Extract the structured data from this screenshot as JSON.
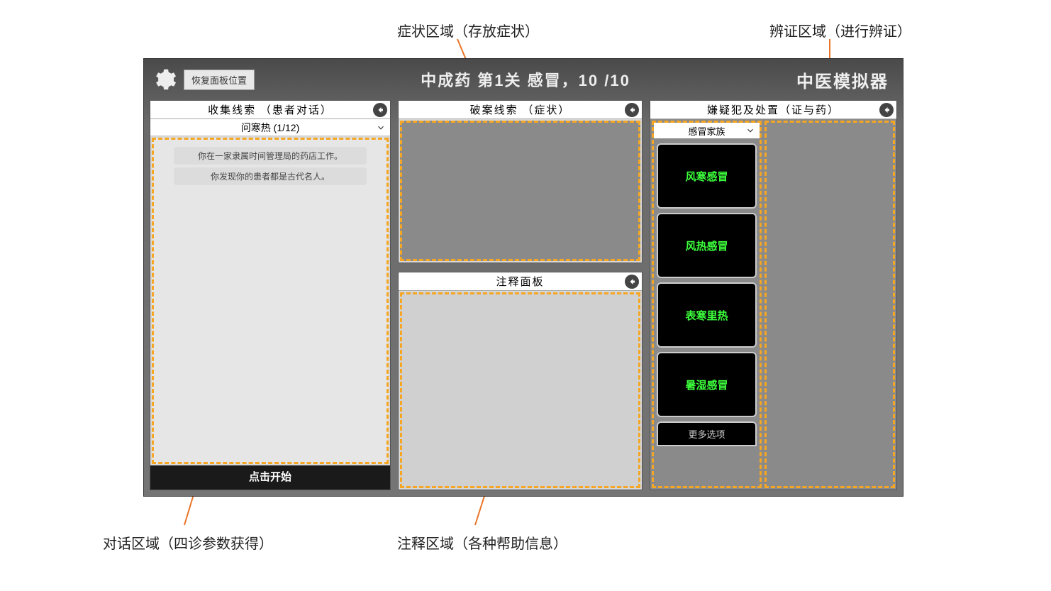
{
  "annotations": {
    "symptom_area": "症状区域（存放症状）",
    "diagnosis_area": "辨证区域（进行辨证）",
    "dialog_area": "对话区域（四诊参数获得）",
    "note_area": "注释区域（各种帮助信息）"
  },
  "topbar": {
    "reset_button": "恢复面板位置",
    "center_title": "中成药  第1关  感冒，10 /10",
    "app_title": "中医模拟器"
  },
  "panel_clues_dialog": {
    "header": "收集线索 （患者对话）",
    "dropdown": "问寒热 (1/12)",
    "messages": [
      "你在一家隶属时间管理局的药店工作。",
      "你发现你的患者都是古代名人。"
    ],
    "start_button": "点击开始"
  },
  "panel_clues_symptom": {
    "header": "破案线索 （症状）"
  },
  "panel_notes": {
    "header": "注释面板"
  },
  "panel_suspects": {
    "header": "嫌疑犯及处置（证与药）",
    "dropdown": "感冒家族",
    "cards": [
      "风寒感冒",
      "风热感冒",
      "表寒里热",
      "暑湿感冒"
    ],
    "more": "更多选项"
  }
}
